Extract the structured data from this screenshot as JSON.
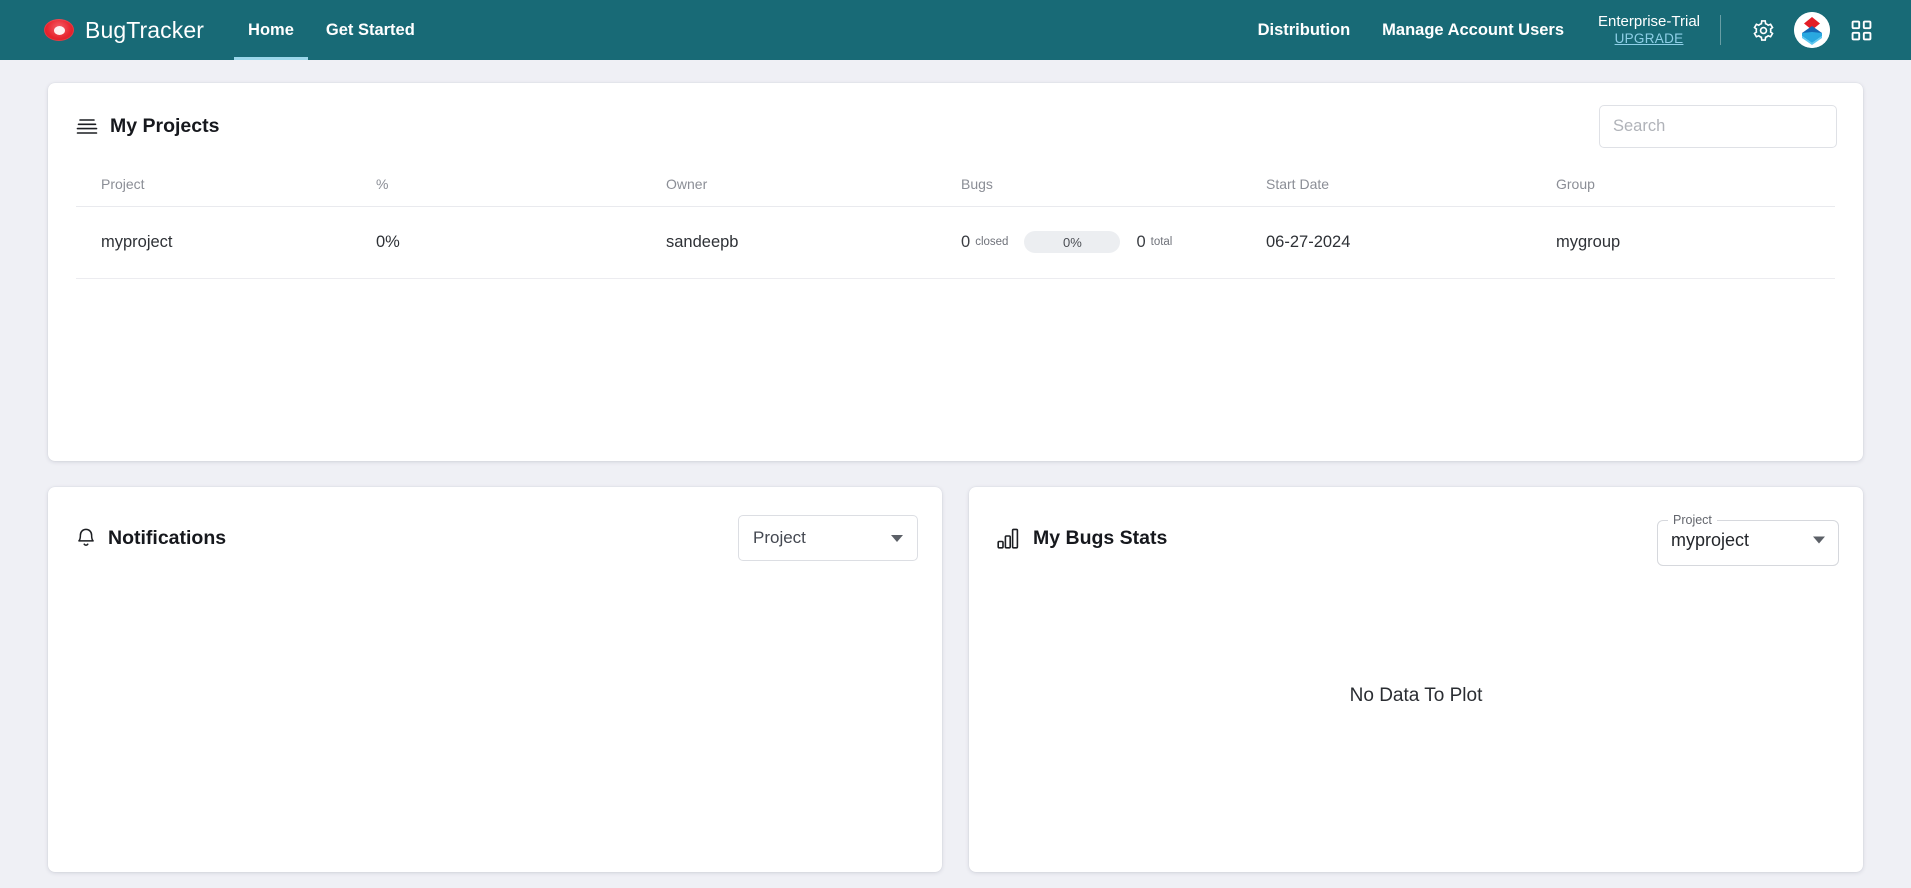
{
  "header": {
    "brand": "BugTracker",
    "brand_logo_icon": "bug-oval-icon",
    "nav": [
      {
        "label": "Home",
        "active": true
      },
      {
        "label": "Get Started",
        "active": false
      }
    ],
    "right_links": [
      {
        "label": "Distribution"
      },
      {
        "label": "Manage Account Users"
      }
    ],
    "plan": {
      "name": "Enterprise-Trial",
      "upgrade_label": "UPGRADE"
    },
    "icons": [
      {
        "name": "gear-icon"
      },
      {
        "name": "avatar-icon"
      },
      {
        "name": "apps-grid-icon"
      }
    ],
    "colors": {
      "bar": "#186a76",
      "active_underline": "#9bd7ea",
      "upgrade_link": "#8fd0e8"
    }
  },
  "projects_panel": {
    "icon": "list-lines-icon",
    "title": "My Projects",
    "search_placeholder": "Search",
    "search_value": "",
    "columns": [
      "Project",
      "%",
      "Owner",
      "Bugs",
      "Start Date",
      "Group"
    ],
    "rows": [
      {
        "project": "myproject",
        "percent": "0%",
        "owner": "sandeepb",
        "bugs_closed_count": "0",
        "bugs_closed_label": "closed",
        "bugs_progress": "0%",
        "bugs_total_count": "0",
        "bugs_total_label": "total",
        "start_date": "06-27-2024",
        "group": "mygroup"
      }
    ]
  },
  "notifications_panel": {
    "icon": "bell-icon",
    "title": "Notifications",
    "project_select_value": "Project",
    "body": ""
  },
  "stats_panel": {
    "icon": "bar-chart-icon",
    "title": "My Bugs Stats",
    "project_select_label": "Project",
    "project_select_value": "myproject",
    "empty_message": "No Data To Plot"
  }
}
